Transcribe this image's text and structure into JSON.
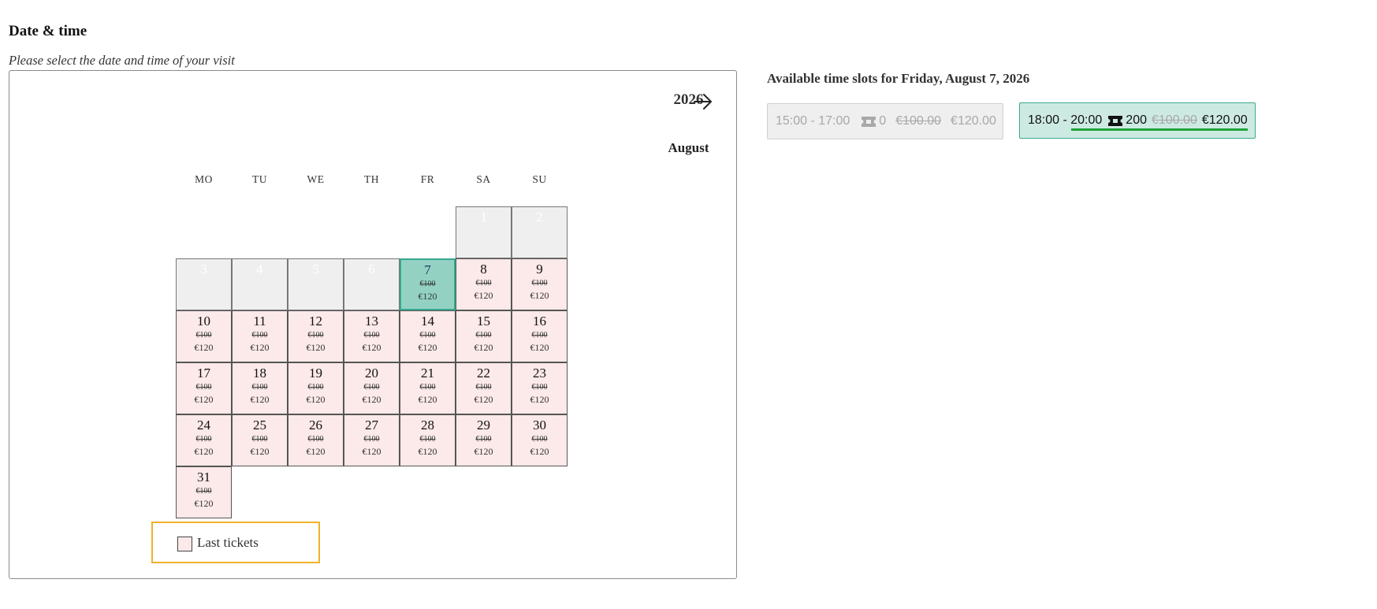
{
  "header": {
    "title": "Date & time",
    "subtitle": "Please select the date and time of your visit"
  },
  "calendar": {
    "year": "2026",
    "month": "August",
    "weekdays": [
      "MO",
      "TU",
      "WE",
      "TH",
      "FR",
      "SA",
      "SU"
    ],
    "old_price": "€100",
    "new_price": "€120",
    "selected_day": 7,
    "days": [
      {
        "day": "1",
        "state": "disabled"
      },
      {
        "day": "2",
        "state": "disabled"
      },
      {
        "day": "3",
        "state": "disabled"
      },
      {
        "day": "4",
        "state": "disabled"
      },
      {
        "day": "5",
        "state": "disabled"
      },
      {
        "day": "6",
        "state": "disabled"
      },
      {
        "day": "7",
        "state": "selected"
      },
      {
        "day": "8",
        "state": "available"
      },
      {
        "day": "9",
        "state": "available"
      },
      {
        "day": "10",
        "state": "available"
      },
      {
        "day": "11",
        "state": "available"
      },
      {
        "day": "12",
        "state": "available"
      },
      {
        "day": "13",
        "state": "available"
      },
      {
        "day": "14",
        "state": "available"
      },
      {
        "day": "15",
        "state": "available"
      },
      {
        "day": "16",
        "state": "available"
      },
      {
        "day": "17",
        "state": "available"
      },
      {
        "day": "18",
        "state": "available"
      },
      {
        "day": "19",
        "state": "available"
      },
      {
        "day": "20",
        "state": "available"
      },
      {
        "day": "21",
        "state": "available"
      },
      {
        "day": "22",
        "state": "available"
      },
      {
        "day": "23",
        "state": "available"
      },
      {
        "day": "24",
        "state": "available"
      },
      {
        "day": "25",
        "state": "available"
      },
      {
        "day": "26",
        "state": "available"
      },
      {
        "day": "27",
        "state": "available"
      },
      {
        "day": "28",
        "state": "available"
      },
      {
        "day": "29",
        "state": "available"
      },
      {
        "day": "30",
        "state": "available"
      },
      {
        "day": "31",
        "state": "available"
      }
    ],
    "first_weekday_index": 5,
    "legend": {
      "label": "Last tickets"
    }
  },
  "slots": {
    "title": "Available time slots for Friday, August 7, 2026",
    "items": [
      {
        "time": "15:00 - 17:00",
        "tickets": "0",
        "old_price": "€100.00",
        "new_price": "€120.00",
        "state": "unavailable"
      },
      {
        "time": "18:00 - 20:00",
        "tickets": "200",
        "old_price": "€100.00",
        "new_price": "€120.00",
        "state": "active"
      }
    ]
  },
  "colors": {
    "available": "#fce9e9",
    "disabled": "#efefef",
    "selected": "#93d2c3",
    "legend_border": "#f0b02a",
    "active_slot": "#cdeae2",
    "active_slot_underline": "#21a33a"
  },
  "icons": {
    "next": "arrow-right-icon",
    "ticket": "ticket-icon"
  }
}
